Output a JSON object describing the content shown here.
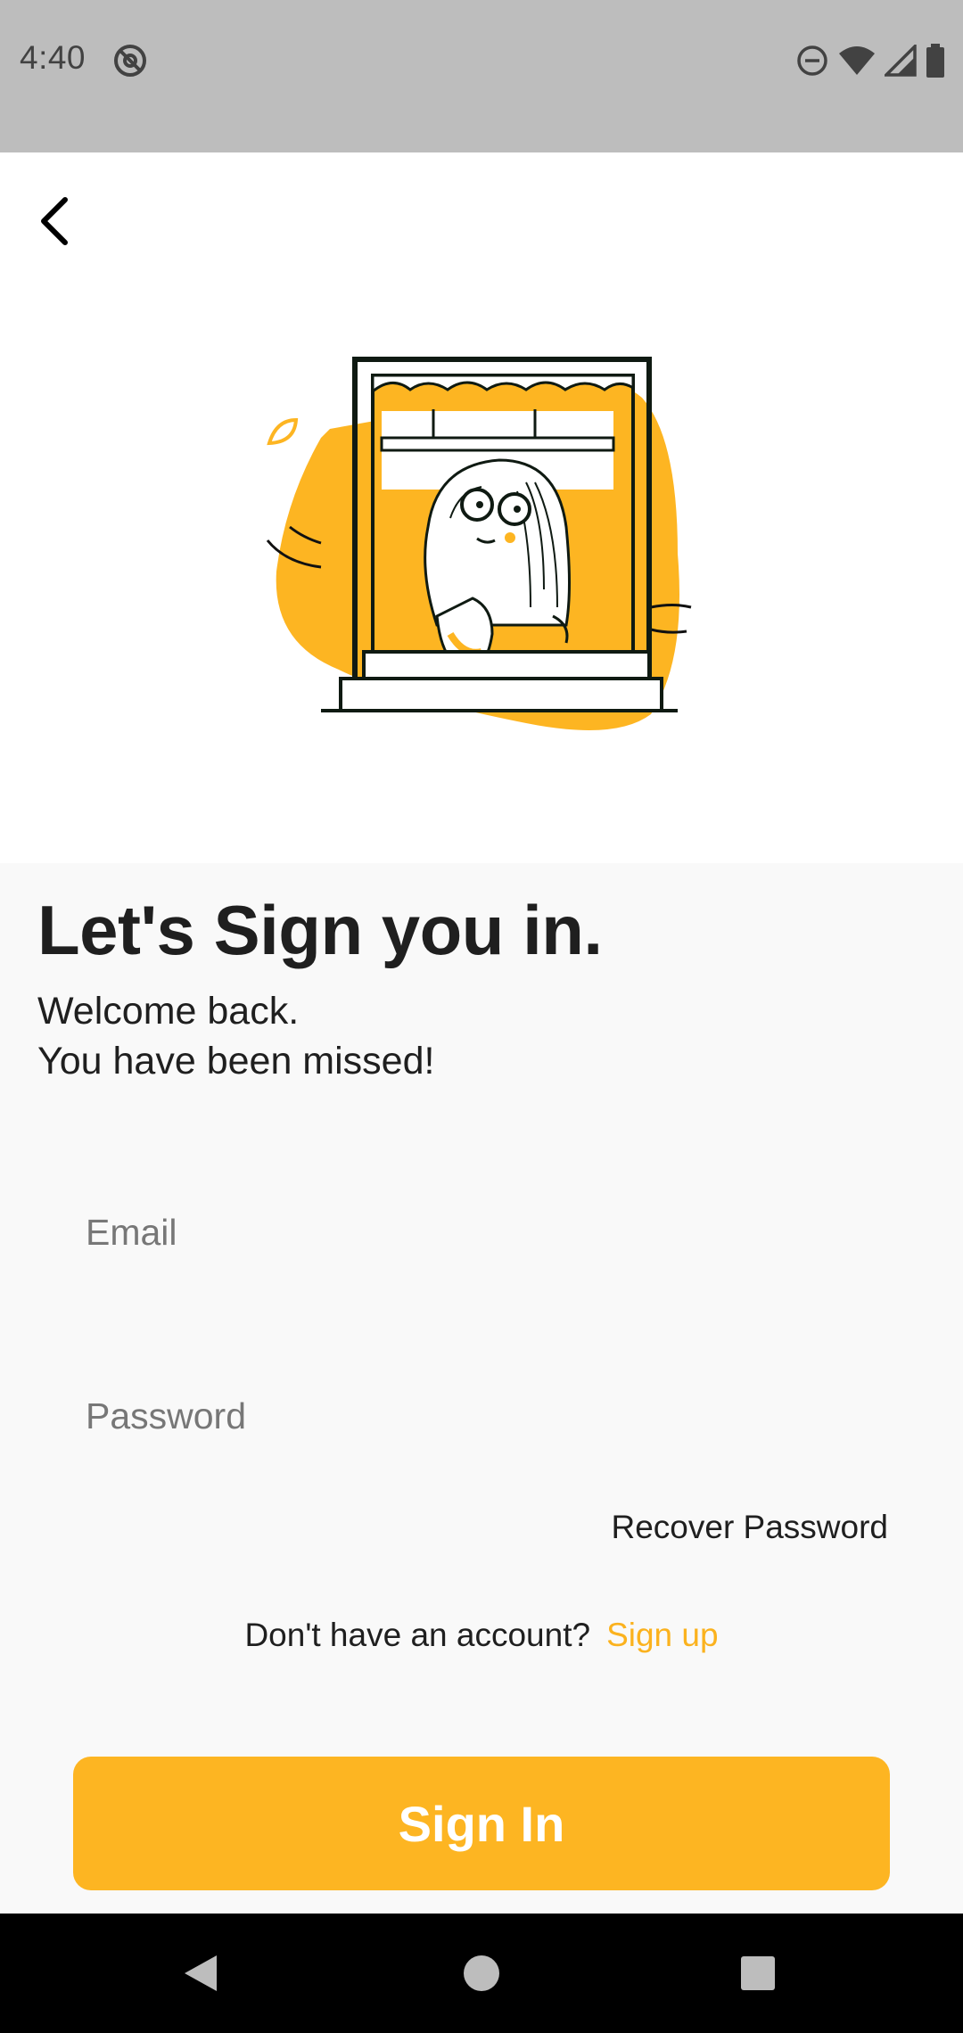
{
  "status_bar": {
    "time": "4:40"
  },
  "header": {
    "back_icon": "chevron-left-icon"
  },
  "illustration": {
    "name": "person-at-window-illustration"
  },
  "signin": {
    "title": "Let's Sign you in.",
    "subtitle_line1": "Welcome back.",
    "subtitle_line2": "You have been missed!",
    "email_placeholder": "Email",
    "password_placeholder": "Password",
    "recover_password": "Recover Password",
    "no_account_text": "Don't have an account?",
    "signup_link": "Sign up",
    "signin_button": "Sign In"
  },
  "colors": {
    "accent": "#fdb522",
    "link": "#fbb21e",
    "text": "#1f1f1f"
  }
}
